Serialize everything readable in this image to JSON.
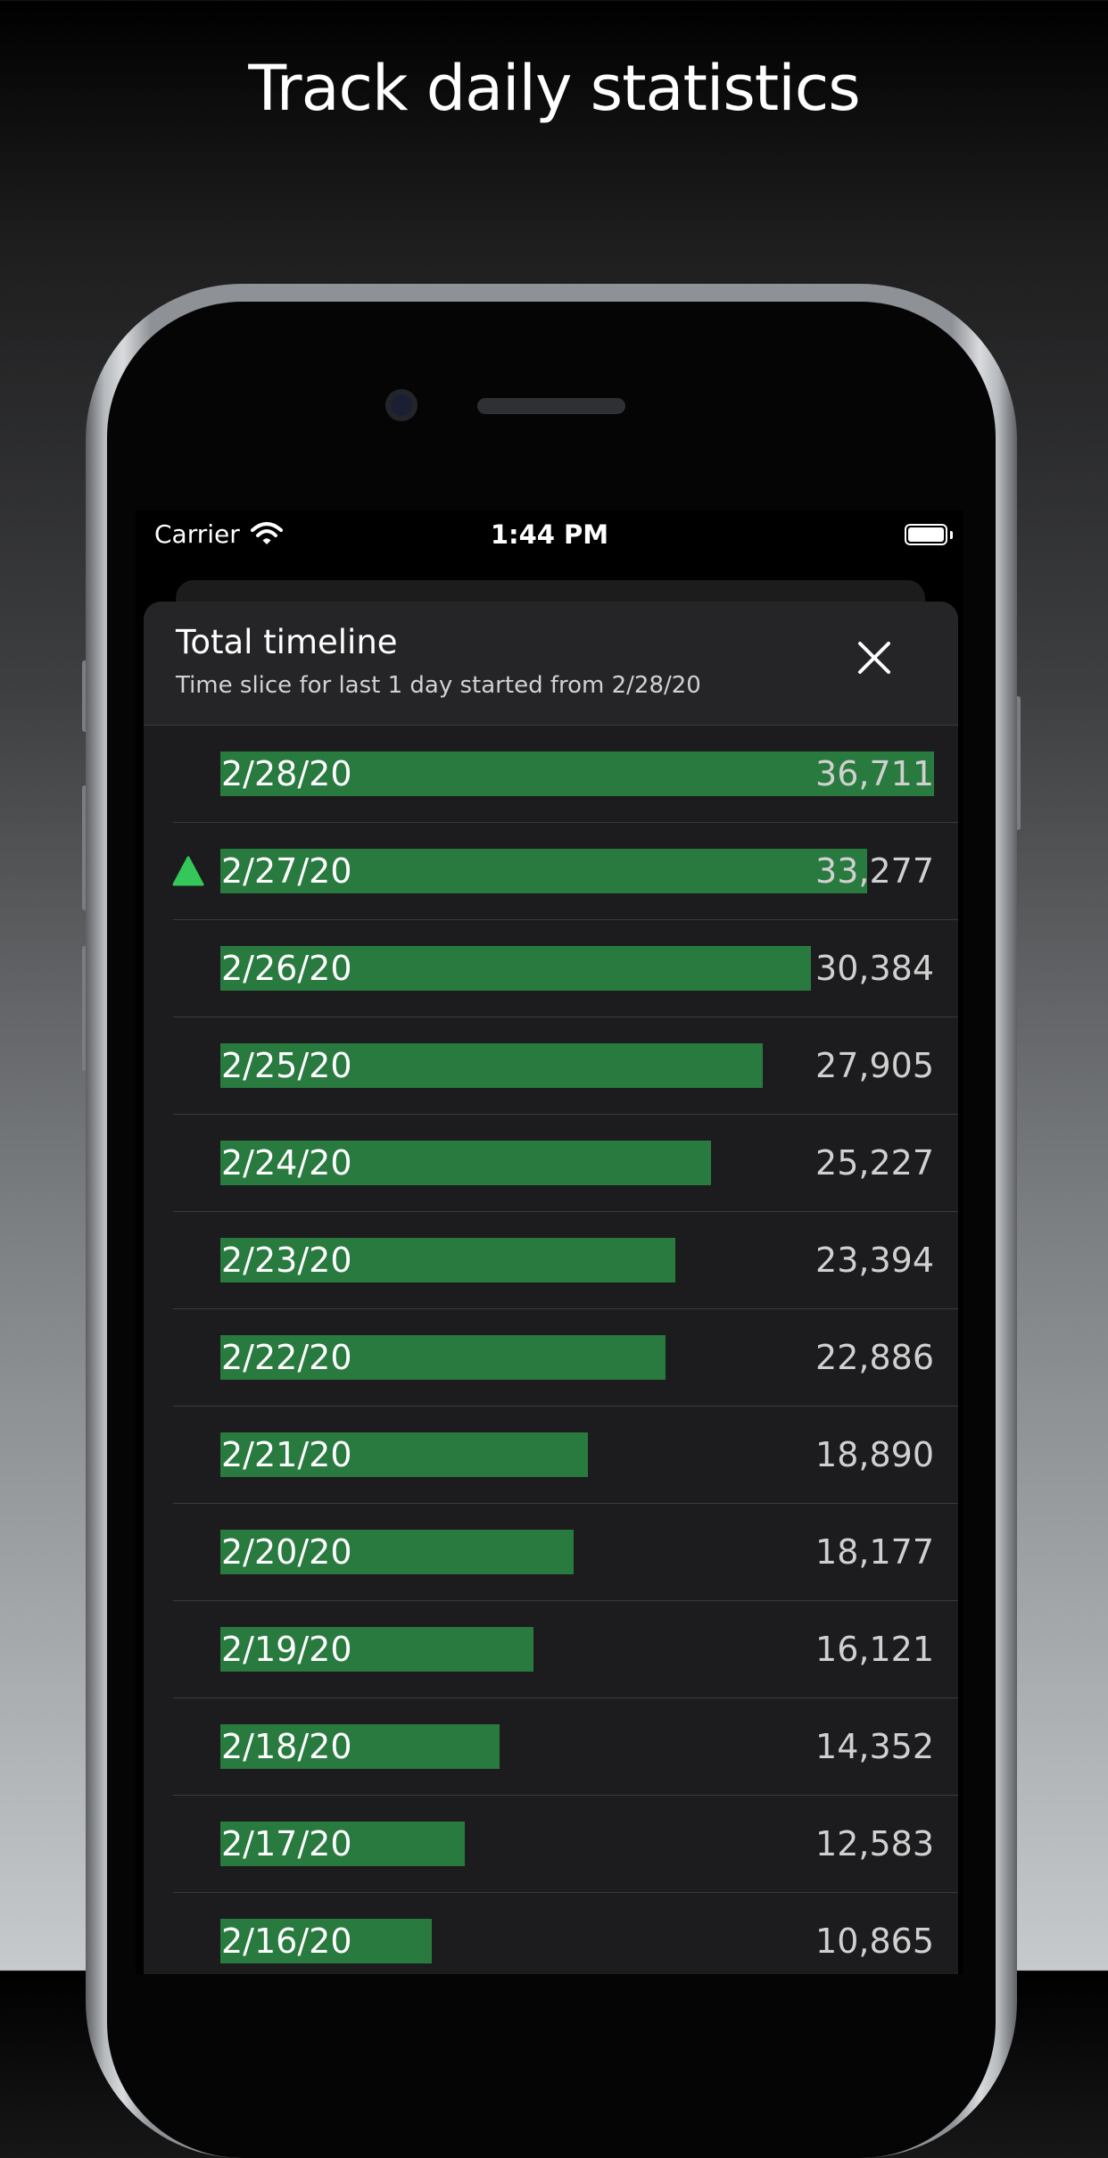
{
  "headline": "Track daily statistics",
  "status_bar": {
    "carrier": "Carrier",
    "time": "1:44 PM"
  },
  "sheet": {
    "title": "Total timeline",
    "subtitle": "Time slice for last 1 day started from 2/28/20"
  },
  "colors": {
    "bar": "#287a3f",
    "trend_up": "#34c759",
    "sheet_bg": "#1c1c1e"
  },
  "icons": {
    "close": "close-icon",
    "trend": "trend-up-icon",
    "wifi": "wifi-icon",
    "battery": "battery-icon"
  },
  "chart_data": {
    "type": "bar",
    "orientation": "horizontal",
    "categories": [
      "2/28/20",
      "2/27/20",
      "2/26/20",
      "2/25/20",
      "2/24/20",
      "2/23/20",
      "2/22/20",
      "2/21/20",
      "2/20/20",
      "2/19/20",
      "2/18/20",
      "2/17/20",
      "2/16/20"
    ],
    "values": [
      36711,
      33277,
      30384,
      27905,
      25227,
      23394,
      22886,
      18890,
      18177,
      16121,
      14352,
      12583,
      10865
    ],
    "value_labels": [
      "36,711",
      "33,277",
      "30,384",
      "27,905",
      "25,227",
      "23,394",
      "22,886",
      "18,890",
      "18,177",
      "16,121",
      "14,352",
      "12,583",
      "10,865"
    ],
    "title": "",
    "xlabel": "",
    "ylabel": "",
    "xlim": [
      0,
      36711
    ],
    "trend_up_rows": [
      "2/27/20"
    ]
  }
}
